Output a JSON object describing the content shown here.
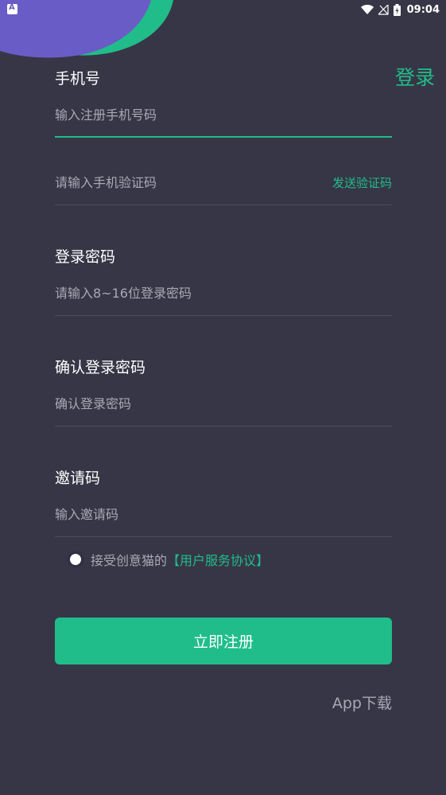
{
  "status_bar": {
    "time": "09:04",
    "notification_icon": "app-notification-icon",
    "wifi_icon": "wifi-icon",
    "signal_icon": "no-signal-icon",
    "battery_icon": "battery-charging-icon"
  },
  "header": {
    "login_link": "登录"
  },
  "form": {
    "phone": {
      "label": "手机号",
      "placeholder": "输入注册手机号码"
    },
    "code": {
      "placeholder": "请输入手机验证码",
      "send_code": "发送验证码"
    },
    "password": {
      "label": "登录密码",
      "placeholder": "请输入8~16位登录密码"
    },
    "confirm": {
      "label": "确认登录密码",
      "placeholder": "确认登录密码"
    },
    "invite": {
      "label": "邀请码",
      "placeholder": "输入邀请码"
    }
  },
  "agreement": {
    "text": "接受创意猫的",
    "link": "【用户服务协议】"
  },
  "submit_label": "立即注册",
  "download_label": "App下载",
  "colors": {
    "background": "#373646",
    "accent": "#20bd8a",
    "decor_purple": "#6a5cc6",
    "muted_text": "#a9a8b4"
  }
}
